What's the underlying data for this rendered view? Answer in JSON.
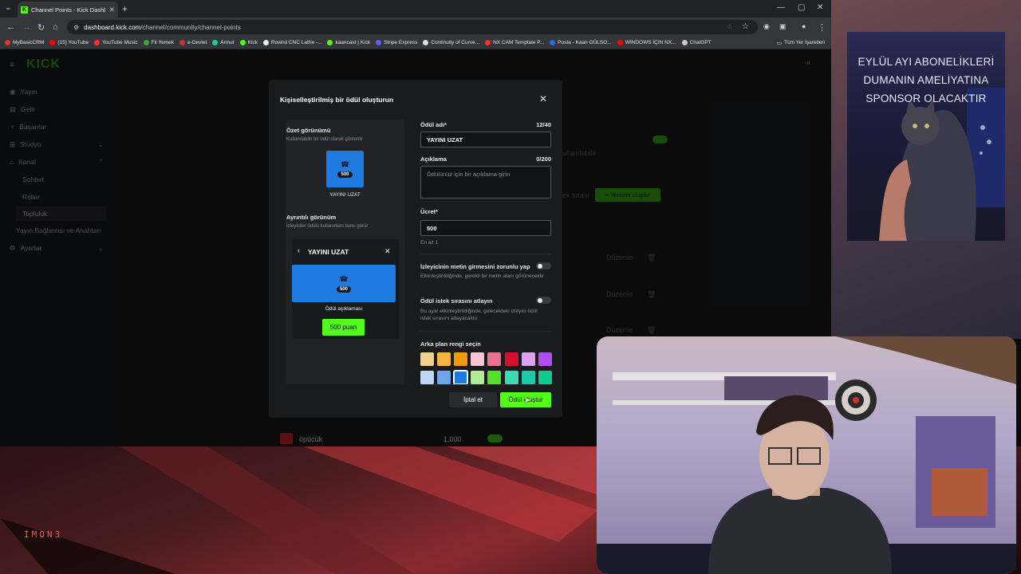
{
  "browser": {
    "tab_title": "Channel Points - Kick Dashbo",
    "url_domain": "dashboard.kick.com",
    "url_path": "/channel/community/channel-points",
    "bookmarks": [
      "MyBasicCRM",
      "(15) YouTube",
      "YouTube Music",
      "Fit Yemek",
      "e-Devlet",
      "Armut",
      "Kick",
      "Rownd CNC Lathe -...",
      "kaancast | Kick",
      "Stripe Express",
      "Continuity of Curve...",
      "NX CAM Template P...",
      "Posta - Kaan GÜLSO...",
      "WİNDOWS İÇİN NX...",
      "ChatGPT"
    ],
    "all_bookmarks": "Tüm Yer İşaretleri"
  },
  "sidebar": {
    "logo": "KICK",
    "items": [
      {
        "label": "Yayın"
      },
      {
        "label": "Gelir"
      },
      {
        "label": "Başarılar"
      },
      {
        "label": "Stüdyo"
      },
      {
        "label": "Kanal"
      },
      {
        "label": "Sohbet"
      },
      {
        "label": "Roller"
      },
      {
        "label": "Topluluk"
      },
      {
        "label": "Yayın Bağlantısı ve Anahtarı"
      },
      {
        "label": "Ayarlar"
      }
    ]
  },
  "background": {
    "create_reward": "+ Yenisini oluştur",
    "request_queue": "ek sırası",
    "edit": "Düzenle",
    "bottom_reward": "öpücük",
    "bottom_cost": "1.000",
    "behind_text": "ullanılabilir"
  },
  "modal": {
    "title": "Kişiselleştirilmiş bir ödül oluşturun",
    "summary_title": "Özet görünümü",
    "summary_sub": "Kullanılabilir bir ödül olarak gösterilir",
    "reward_cost": "500",
    "reward_name": "YAYINI UZAT",
    "detail_title": "Ayrıntılı görünüm",
    "detail_sub": "İzleyiciler ödülü kullanırken bunu görür",
    "detail_desc": "Ödül açıklaması",
    "points_button": "500 puan",
    "name_label": "Ödül adı*",
    "name_count": "12/40",
    "name_value": "YAYINI UZAT",
    "desc_label": "Açıklama",
    "desc_count": "0/200",
    "desc_placeholder": "Ödülünüz için bir açıklama girin",
    "cost_label": "Ücret*",
    "cost_value": "500",
    "cost_hint": "En az 1",
    "toggle1_label": "İzleyicinin metin girmesini zorunlu yap",
    "toggle1_desc": "Etkinleştirildiğinde, gerekli bir metin alanı görünecektir",
    "toggle2_label": "Ödül istek sırasını atlayın",
    "toggle2_desc": "Bu ayar etkinleştirildiğinde, gelecekteki izleyici ödül istek sırasını atlayacaktır.",
    "color_label": "Arka plan rengi seçin",
    "colors": [
      "#f5cf8d",
      "#f2b53d",
      "#ef9a0a",
      "#f7c4cf",
      "#e8728f",
      "#d5102e",
      "#dca1f0",
      "#b14bf2",
      "#bfd6f5",
      "#6ea6ee",
      "#1f7ae0",
      "#b2ec9a",
      "#53e02a",
      "#3ed8b3",
      "#1dc9a8",
      "#12c98d"
    ],
    "cancel_button": "İptal et",
    "create_button": "Ödül oluştur"
  },
  "overlay": {
    "banner_line1": "EYLÜL AYI ABONELİKLERİ",
    "banner_line2": "DUMANIN AMELİYATINA",
    "banner_line3": "SPONSOR OLACAKTIR",
    "logo_text": "IMON3"
  }
}
